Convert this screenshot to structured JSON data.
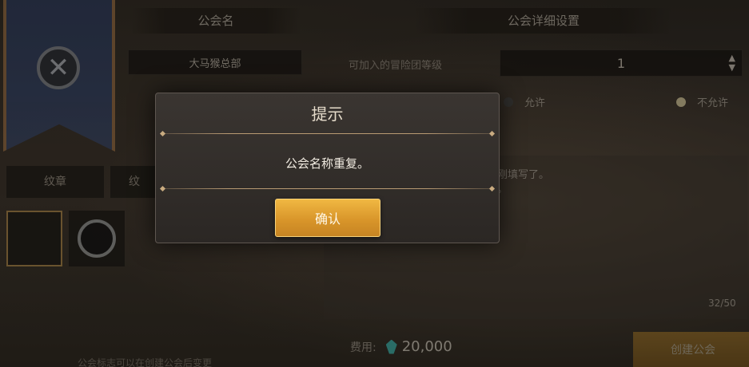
{
  "background": {
    "headers": {
      "guild_name": "公会名",
      "guild_details": "公会详细设置"
    },
    "guild_name_value": "大马猴总部",
    "join_level_label": "可加入的冒险团等级",
    "join_level_value": "1",
    "radios": {
      "allow": "允许",
      "disallow": "不允许"
    },
    "tabs": {
      "emblem": "纹章",
      "second": "纹"
    },
    "desc_lines": [
      "刚填写了。",
      "。"
    ],
    "char_count": "32/50",
    "cost_label": "费用:",
    "cost_amount": "20,000",
    "create_button": "创建公会",
    "footnote": "公会标志可以在创建公会后变更"
  },
  "dialog": {
    "title": "提示",
    "message": "公会名称重复。",
    "confirm_label": "确认"
  },
  "colors": {
    "accent": "#e0a030",
    "gem": "#3fb7b0"
  }
}
